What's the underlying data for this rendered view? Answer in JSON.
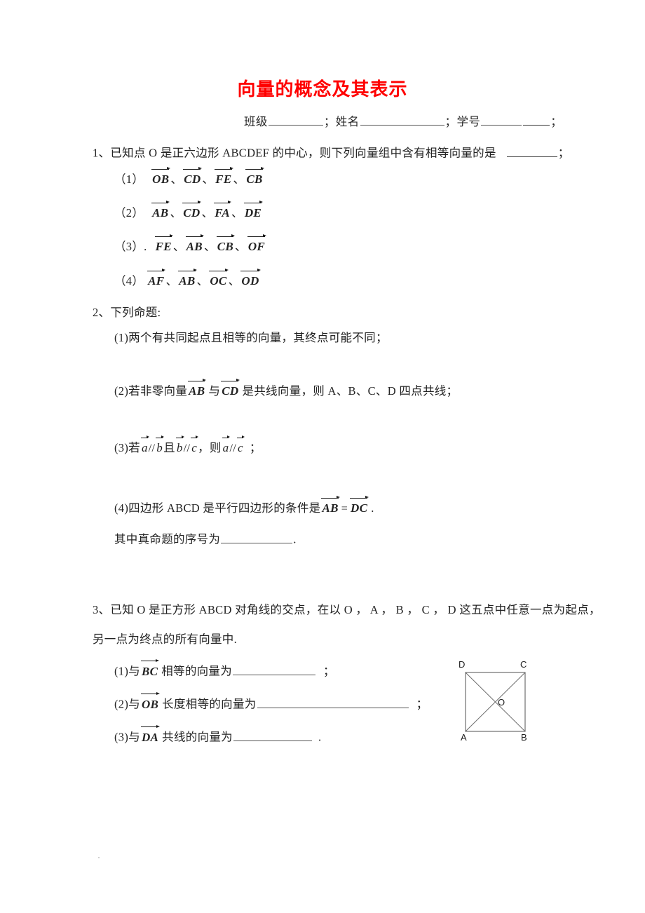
{
  "document": {
    "title": "向量的概念及其表示",
    "title_color": "#ff0000",
    "header": {
      "class_label": "班级",
      "name_label": "姓名",
      "id_label": "学号",
      "sep1": "；",
      "sep2": "；",
      "sep3": "；"
    }
  },
  "q1": {
    "number": "1、",
    "stem_a": "已知点 O 是正六边形 ABCDEF 的中心，则下列向量组中含有相等向量的是",
    "stem_end": "；",
    "options": [
      {
        "marker": "（1）",
        "vectors": [
          "OB",
          "CD",
          "FE",
          "CB"
        ]
      },
      {
        "marker": "（2）",
        "vectors": [
          "AB",
          "CD",
          "FA",
          "DE"
        ]
      },
      {
        "marker": "（3）.",
        "vectors": [
          "FE",
          "AB",
          "CB",
          "OF"
        ]
      },
      {
        "marker": "（4）",
        "vectors": [
          "AF",
          "AB",
          "OC",
          "OD"
        ]
      }
    ],
    "vector_sep": "、"
  },
  "q2": {
    "number": "2、",
    "stem": "下列命题:",
    "items": [
      {
        "marker": "(1)",
        "text": "两个有共同起点且相等的向量，其终点可能不同；"
      },
      {
        "marker": "(2)",
        "text_a": "若非零向量",
        "vec1": "AB",
        "text_b": "与",
        "vec2": "CD",
        "text_c": "是共线向量，则 A、B、C、D 四点共线；"
      },
      {
        "marker": "(3)",
        "text_a": "若",
        "v_a": "a",
        "op1": "//",
        "v_b": "b",
        "text_b": "且",
        "v_b2": "b",
        "op2": "//",
        "v_c": "c",
        "text_c": "，则",
        "v_a2": "a",
        "op3": "//",
        "v_c2": "c",
        "text_d": "；"
      },
      {
        "marker": "(4)",
        "text_a": "四边形 ABCD 是平行四边形的条件是",
        "vec1": "AB",
        "eq": "=",
        "vec2": "DC",
        "text_b": "."
      }
    ],
    "conclusion_a": "其中真命题的序号为",
    "conclusion_b": "."
  },
  "q3": {
    "number": "3、",
    "stem_line1": "已知 O 是正方形 ABCD 对角线的交点，在以 O ， A ， B ， C ， D 这五点中任意一点为起点，",
    "stem_line2": "另一点为终点的所有向量中.",
    "items": [
      {
        "marker": "(1)",
        "text_a": "与",
        "vec": "BC",
        "text_b": "相等的向量为",
        "text_c": "；"
      },
      {
        "marker": "(2)",
        "text_a": "与",
        "vec": "OB",
        "text_b": "长度相等的向量为",
        "text_c": "；"
      },
      {
        "marker": "(3)",
        "text_a": "与",
        "vec": "DA",
        "text_b": "共线的向量为",
        "text_c": "."
      }
    ],
    "figure": {
      "name": "square-with-diagonals",
      "vertices": [
        {
          "label": "D",
          "pos": "top-left"
        },
        {
          "label": "C",
          "pos": "top-right"
        },
        {
          "label": "A",
          "pos": "bottom-left"
        },
        {
          "label": "B",
          "pos": "bottom-right"
        }
      ],
      "center_label": "O",
      "stroke_color": "#6e6e6e"
    }
  }
}
